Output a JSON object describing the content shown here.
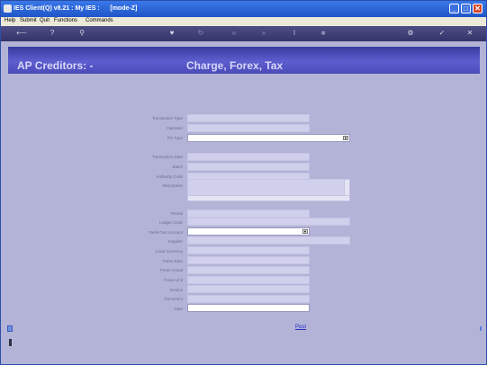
{
  "window": {
    "title": "IES Client(Q) v8.21 : My IES :      [mode-Z]"
  },
  "menu": [
    "Help",
    "Submit",
    "Quit",
    "Functions",
    "Commands"
  ],
  "toolbar_icons": [
    "back-icon",
    "help-icon",
    "search-icon",
    "heart-icon",
    "refresh-icon",
    "rewind-icon",
    "fast-forward-icon",
    "pause-icon",
    "stop-icon",
    "settings-icon",
    "check-icon",
    "close-icon"
  ],
  "banner": {
    "left": "AP Creditors: -",
    "right": "Charge, Forex, Tax"
  },
  "form": {
    "labels": {
      "transaction_type": "Transaction Type",
      "operator": "Operator",
      "fin_type": "Fin Type",
      "transaction_date": "Transaction Date",
      "batch": "Batch",
      "authority_code": "Authority Code",
      "description": "Description",
      "period": "Period",
      "ledger_code": "Ledger Code",
      "debit_gen_account": "Debit Gen Account",
      "supplier": "Supplier",
      "local_currency": "Local Currency",
      "forex_rate": "Forex Rate",
      "forex_actual": "Forex Actual",
      "forex_unit": "Forex Unit",
      "invoice": "Invoice",
      "document": "Document",
      "note": "Note"
    }
  },
  "post_label": "Post",
  "colors": {
    "title_bar": "#2a62d8",
    "banner": "#4a4ab8",
    "background": "#b3b3d8",
    "field": "#d0d0ec"
  }
}
